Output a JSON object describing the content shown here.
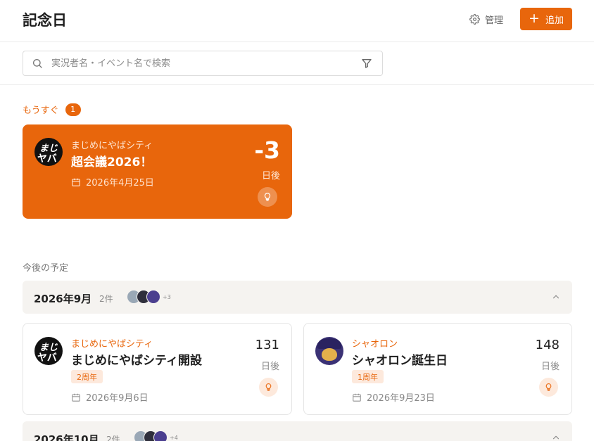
{
  "header": {
    "title": "記念日",
    "manage_label": "管理",
    "add_label": "追加",
    "accent": "#e8660c"
  },
  "search": {
    "placeholder": "実況者名・イベント名で検索",
    "value": ""
  },
  "soon": {
    "label": "もうすぐ",
    "count": "1",
    "item": {
      "channel": "まじめにやばシティ",
      "event": "超会議2026！",
      "date": "2026年4月25日",
      "days": "-3",
      "days_unit": "日後",
      "avatar_text_1": "まじ",
      "avatar_text_2": "ヤバ"
    }
  },
  "upcoming": {
    "label": "今後の予定",
    "months": [
      {
        "title": "2026年9月",
        "count": "2件",
        "more": "+3",
        "cards": [
          {
            "channel": "まじめにやばシティ",
            "event": "まじめにやばシティ開設",
            "badge": "2周年",
            "date": "2026年9月6日",
            "days": "131",
            "days_unit": "日後",
            "avatar_text_1": "まじ",
            "avatar_text_2": "ヤバ"
          },
          {
            "channel": "シャオロン",
            "event": "シャオロン誕生日",
            "badge": "1周年",
            "date": "2026年9月23日",
            "days": "148",
            "days_unit": "日後"
          }
        ]
      },
      {
        "title": "2026年10月",
        "count": "2件",
        "more": "+4"
      }
    ]
  }
}
